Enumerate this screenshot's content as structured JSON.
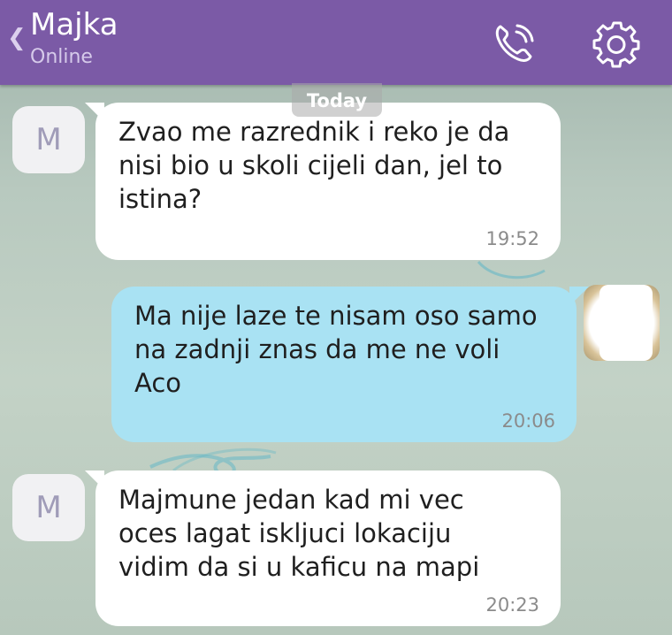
{
  "header": {
    "back_icon": "chevron-left-icon",
    "contact_name": "Majka",
    "status": "Online",
    "call_icon": "phone-call-icon",
    "settings_icon": "gear-icon"
  },
  "date_divider": "Today",
  "messages": [
    {
      "direction": "incoming",
      "avatar_initial": "M",
      "text": "Zvao me razrednik i reko je da\nnisi bio u skoli cijeli dan, jel to\nistina?",
      "time": "19:52"
    },
    {
      "direction": "outgoing",
      "text": "Ma nije laze te nisam oso samo\nna zadnji  znas da me ne voli\nAco",
      "time": "20:06"
    },
    {
      "direction": "incoming",
      "avatar_initial": "M",
      "text": "Majmune jedan kad mi vec\noces lagat iskljuci lokaciju\nvidim da si u kaficu na mapi",
      "time": "20:23"
    }
  ],
  "colors": {
    "header": "#7b5aa6",
    "incoming_bubble": "#ffffff",
    "outgoing_bubble": "#a9e2f3"
  }
}
